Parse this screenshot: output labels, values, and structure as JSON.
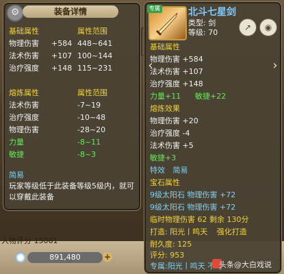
{
  "background": {
    "score_label": "人物评分",
    "score_value": "15061",
    "money": "891,480",
    "plus": "+"
  },
  "left_panel": {
    "title": "装备详情",
    "base_header": "基础属性",
    "range_header": "属性范围",
    "base_rows": [
      {
        "name": "物理伤害",
        "value": "+584",
        "range": "448~641"
      },
      {
        "name": "法术伤害",
        "value": "+107",
        "range": "100~144"
      },
      {
        "name": "治疗强度",
        "value": "+148",
        "range": "115~231"
      }
    ],
    "refine_header": "熔炼属性",
    "refine_range_header": "属性范围",
    "refine_rows": [
      {
        "name": "法术伤害",
        "range": "-7~19",
        "color": "white"
      },
      {
        "name": "治疗强度",
        "range": "-10~48",
        "color": "white"
      },
      {
        "name": "物理伤害",
        "range": "-28~20",
        "color": "white"
      },
      {
        "name": "力量",
        "range": "-8~11",
        "color": "green"
      },
      {
        "name": "敏捷",
        "range": "-8~3",
        "color": "green"
      }
    ],
    "brief_header": "简易",
    "description": "玩家等级低于此装备等级5级内，就可以穿戴此装备"
  },
  "right_panel": {
    "tag": "专属",
    "name": "北斗七星剑",
    "type": "类型: 剑",
    "level": "等级: 70",
    "base_header": "基础属性",
    "base_rows": [
      "物理伤害 +584",
      "法术伤害 +107",
      "治疗强度 +148"
    ],
    "str_text": "力量+11",
    "agi_text": "敏捷+22",
    "refine_header": "熔炼效果",
    "refine_rows": [
      "物理伤害 +20",
      "治疗强度 -4",
      "法术伤害 +5"
    ],
    "refine_agi": "敏捷+3",
    "special_label": "特效",
    "special_value": "简易",
    "gem_header": "宝石属性",
    "gem_rows": [
      "9级太阳石  物理伤害 +72",
      "9级太阳石  物理伤害 +72"
    ],
    "temp_line": "临时物理伤害 62 剩余 130分",
    "forge_line": "打造: 阳光丨鸣天",
    "forge_strength": "强化打造",
    "durability": "耐久度: 125",
    "rating": "评分: 953",
    "exclusive": "专属:阳光丨鸣天 不可",
    "watermark": "头条@大白戏说"
  },
  "colors": {
    "yellow": "#f2d33a",
    "green": "#67e75a",
    "cyan": "#7fd2f0",
    "white": "#f2f2f2"
  }
}
